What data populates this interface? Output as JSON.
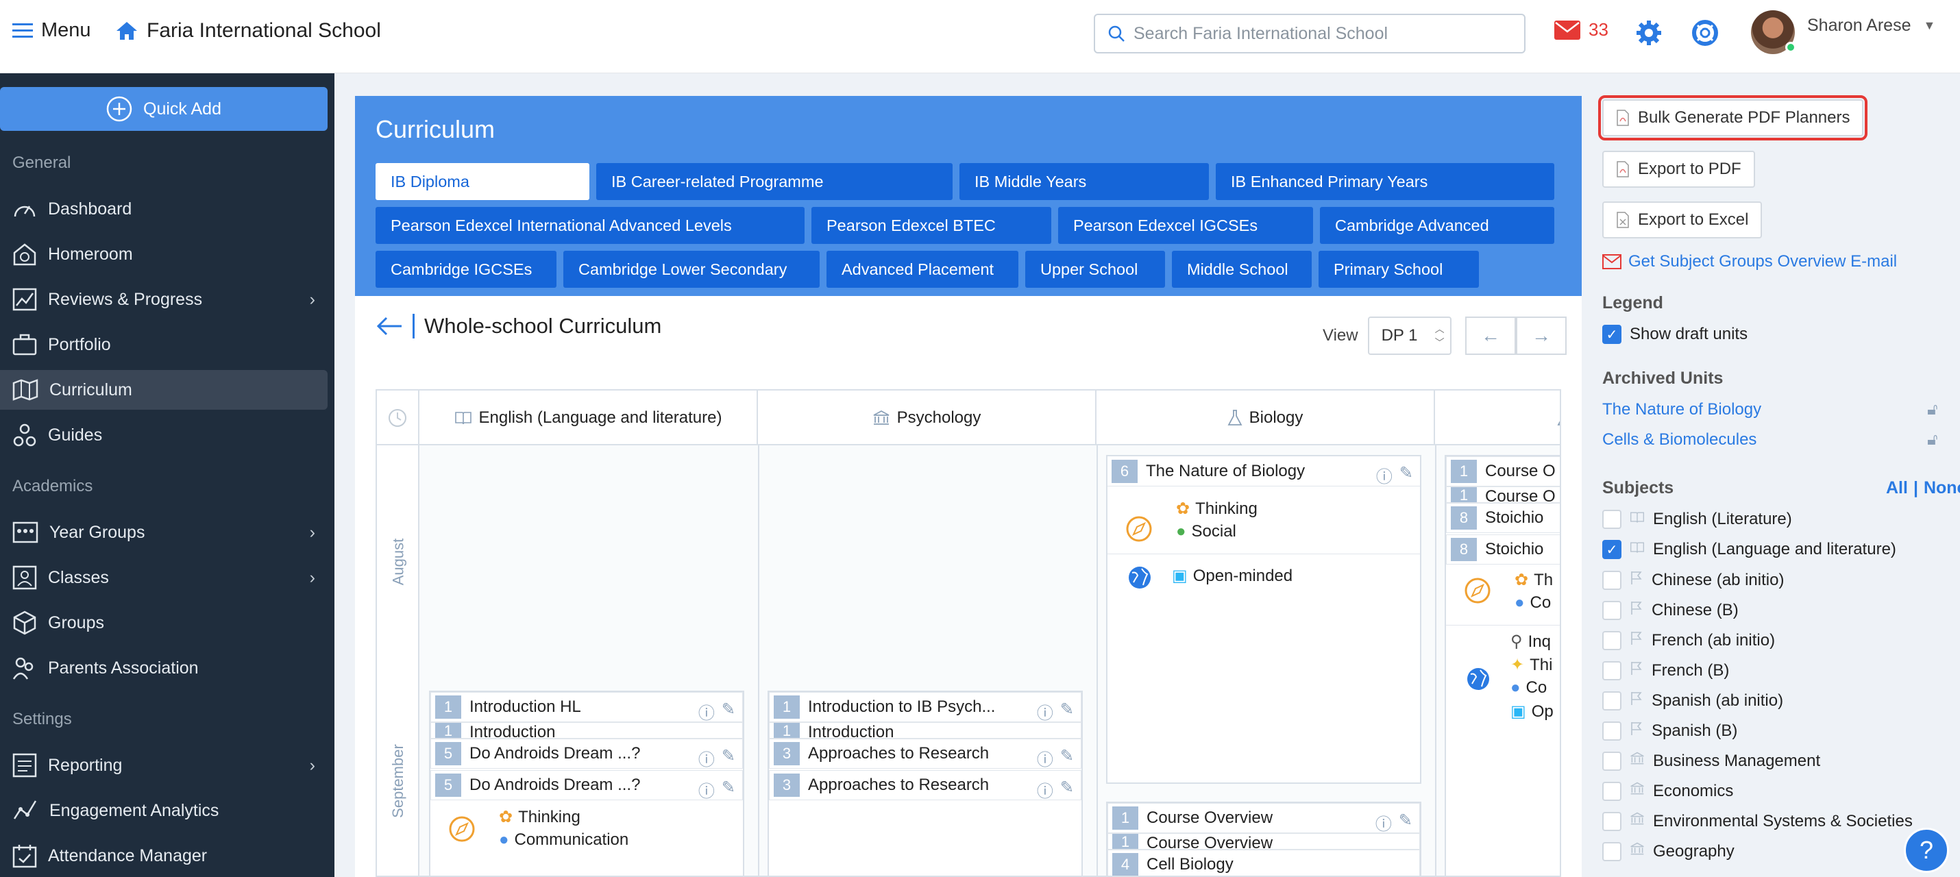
{
  "topbar": {
    "menu_label": "Menu",
    "school_name": "Faria International School",
    "search_placeholder": "Search Faria International School",
    "mail_count": "33",
    "user_name": "Sharon Arese"
  },
  "sidebar": {
    "quick_add": "Quick Add",
    "sections": {
      "general": "General",
      "academics": "Academics",
      "settings": "Settings"
    },
    "items": [
      {
        "label": "Dashboard",
        "icon": "dashboard-icon"
      },
      {
        "label": "Homeroom",
        "icon": "homeroom-icon"
      },
      {
        "label": "Reviews & Progress",
        "icon": "chart-icon"
      },
      {
        "label": "Portfolio",
        "icon": "briefcase-icon"
      },
      {
        "label": "Curriculum",
        "icon": "map-icon"
      },
      {
        "label": "Guides",
        "icon": "guides-icon"
      },
      {
        "label": "Year Groups",
        "icon": "year-groups-icon"
      },
      {
        "label": "Classes",
        "icon": "classes-icon"
      },
      {
        "label": "Groups",
        "icon": "cube-icon"
      },
      {
        "label": "Parents Association",
        "icon": "parents-icon"
      },
      {
        "label": "Reporting",
        "icon": "reporting-icon"
      },
      {
        "label": "Engagement Analytics",
        "icon": "analytics-icon"
      },
      {
        "label": "Attendance Manager",
        "icon": "attendance-icon"
      }
    ]
  },
  "curriculum": {
    "title": "Curriculum",
    "programmes": [
      "IB Diploma",
      "IB Career-related Programme",
      "IB Middle Years",
      "IB Enhanced Primary Years",
      "Pearson Edexcel International Advanced Levels",
      "Pearson Edexcel BTEC",
      "Pearson Edexcel IGCSEs",
      "Cambridge Advanced",
      "Cambridge IGCSEs",
      "Cambridge Lower Secondary",
      "Advanced Placement",
      "Upper School",
      "Middle School",
      "Primary School"
    ],
    "page_title": "Whole-school Curriculum",
    "view_label": "View",
    "view_value": "DP 1",
    "columns": [
      "English (Language and literature)",
      "Psychology",
      "Biology"
    ],
    "months": [
      "August",
      "September"
    ],
    "units": {
      "english": [
        {
          "num": "1",
          "title": "Introduction HL"
        },
        {
          "num": "1",
          "title": "Introduction"
        },
        {
          "num": "5",
          "title": "Do Androids Dream ...?"
        },
        {
          "num": "5",
          "title": "Do Androids Dream ...?"
        }
      ],
      "english_skills": [
        "Thinking",
        "Communication"
      ],
      "psychology": [
        {
          "num": "1",
          "title": "Introduction to IB Psych..."
        },
        {
          "num": "1",
          "title": "Introduction"
        },
        {
          "num": "3",
          "title": "Approaches to Research"
        },
        {
          "num": "3",
          "title": "Approaches to Research"
        }
      ],
      "biology_top": {
        "num": "6",
        "title": "The Nature of Biology"
      },
      "biology_skills": [
        "Thinking",
        "Social"
      ],
      "biology_profile": "Open-minded",
      "biology_bottom": [
        {
          "num": "1",
          "title": "Course Overview"
        },
        {
          "num": "1",
          "title": "Course Overview"
        },
        {
          "num": "4",
          "title": "Cell Biology"
        }
      ],
      "col4": [
        {
          "num": "1",
          "title": "Course O"
        },
        {
          "num": "1",
          "title": "Course O"
        },
        {
          "num": "8",
          "title": "Stoichio"
        },
        {
          "num": "8",
          "title": "Stoichio"
        }
      ],
      "col4_skills": [
        "Th",
        "Co"
      ],
      "col4_profiles": [
        "Inq",
        "Thi",
        "Co",
        "Op"
      ]
    }
  },
  "right_panel": {
    "bulk_generate": "Bulk Generate PDF Planners",
    "export_pdf": "Export to PDF",
    "export_excel": "Export to Excel",
    "email_link": "Get Subject Groups Overview E-mail",
    "legend_title": "Legend",
    "show_draft": "Show draft units",
    "archived_title": "Archived Units",
    "archived": [
      "The Nature of Biology",
      "Cells & Biomolecules"
    ],
    "subjects_title": "Subjects",
    "all_label": "All",
    "sep": "|",
    "none_label": "None",
    "subjects": [
      {
        "name": "English (Literature)",
        "checked": false
      },
      {
        "name": "English (Language and literature)",
        "checked": true
      },
      {
        "name": "Chinese (ab initio)",
        "checked": false
      },
      {
        "name": "Chinese (B)",
        "checked": false
      },
      {
        "name": "French (ab initio)",
        "checked": false
      },
      {
        "name": "French (B)",
        "checked": false
      },
      {
        "name": "Spanish (ab initio)",
        "checked": false
      },
      {
        "name": "Spanish (B)",
        "checked": false
      },
      {
        "name": "Business Management",
        "checked": false
      },
      {
        "name": "Economics",
        "checked": false
      },
      {
        "name": "Environmental Systems & Societies",
        "checked": false
      },
      {
        "name": "Geography",
        "checked": false
      }
    ]
  },
  "colors": {
    "primary": "#4a8fe7",
    "tab": "#1565d8",
    "sidebar": "#1f2d3d",
    "alert": "#e53935"
  }
}
